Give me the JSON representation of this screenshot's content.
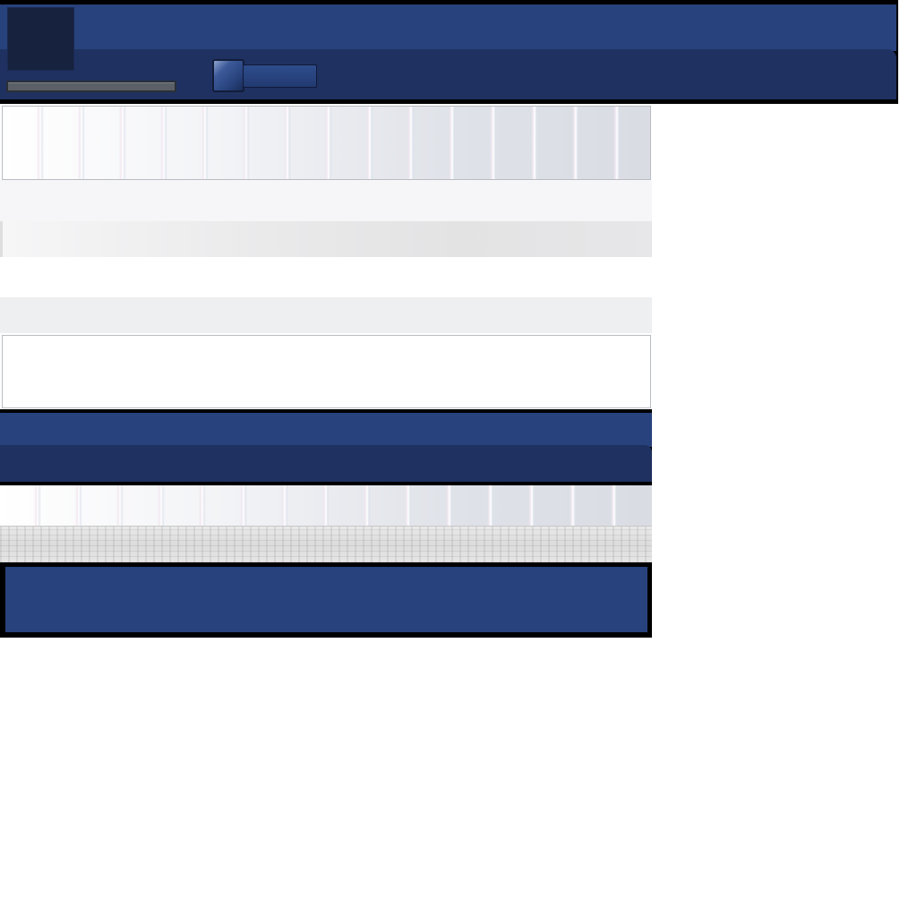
{
  "colors": {
    "brand_blue": "#27427c",
    "brand_blue_dark": "#1f3160",
    "logo_dark": "#17223f",
    "frame_black": "#000000",
    "track_gray": "#5b5f66",
    "panel_border": "#b9bcc2",
    "band_light": "#f6f5f7",
    "band_gray": "#eeeff0"
  },
  "icons": {
    "logo": "logo-placeholder-icon",
    "toggle": "toggle-switch-icon"
  }
}
